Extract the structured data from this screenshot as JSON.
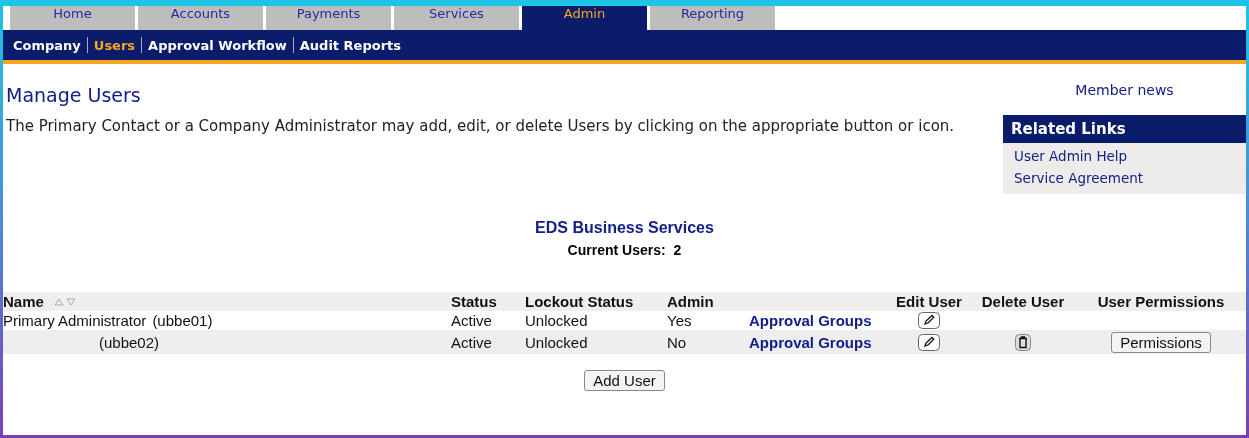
{
  "tabs": [
    {
      "label": "Home",
      "selected": false
    },
    {
      "label": "Accounts",
      "selected": false
    },
    {
      "label": "Payments",
      "selected": false
    },
    {
      "label": "Services",
      "selected": false
    },
    {
      "label": "Admin",
      "selected": true
    },
    {
      "label": "Reporting",
      "selected": false
    }
  ],
  "subnav": [
    {
      "label": "Company",
      "selected": false
    },
    {
      "label": "Users",
      "selected": true
    },
    {
      "label": "Approval Workflow",
      "selected": false
    },
    {
      "label": "Audit Reports",
      "selected": false
    }
  ],
  "page_title": "Manage Users",
  "description": "The Primary Contact or a Company Administrator may add, edit, or delete Users by clicking on the appropriate button or icon.",
  "member_news": "Member news",
  "related_links": {
    "title": "Related Links",
    "items": [
      "User Admin Help",
      "Service Agreement"
    ]
  },
  "company": {
    "name": "EDS Business Services",
    "current_users_label": "Current Users:",
    "current_users_count": "2"
  },
  "table": {
    "columns": [
      "Name",
      "Status",
      "Lockout Status",
      "Admin",
      "Edit User",
      "Delete User",
      "User Permissions"
    ],
    "rows": [
      {
        "full_name": "Primary Administrator",
        "user_id": "(ubbe01)",
        "status": "Active",
        "lockout_status": "Unlocked",
        "admin": "Yes",
        "approval_groups": "Approval Groups",
        "can_delete": false
      },
      {
        "user_id": "(ubbe02)",
        "status": "Active",
        "lockout_status": "Unlocked",
        "admin": "No",
        "approval_groups": "Approval Groups",
        "can_delete": true,
        "permissions_button": "Permissions"
      }
    ]
  },
  "add_button": "Add User"
}
